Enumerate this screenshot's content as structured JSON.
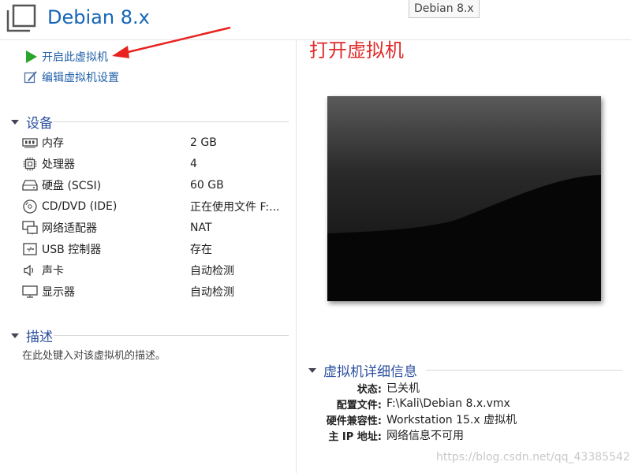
{
  "window": {
    "title": "Debian 8.x",
    "tooltip": "Debian 8.x"
  },
  "actions": [
    {
      "label": "开启此虚拟机",
      "icon": "play-icon"
    },
    {
      "label": "编辑虚拟机设置",
      "icon": "edit-settings-icon"
    }
  ],
  "devices": {
    "header": "设备",
    "items": [
      {
        "name": "内存",
        "value": "2 GB",
        "icon": "memory-icon"
      },
      {
        "name": "处理器",
        "value": "4",
        "icon": "cpu-icon"
      },
      {
        "name": "硬盘 (SCSI)",
        "value": "60 GB",
        "icon": "hard-disk-icon"
      },
      {
        "name": "CD/DVD (IDE)",
        "value": "正在使用文件 F:...",
        "icon": "cd-dvd-icon"
      },
      {
        "name": "网络适配器",
        "value": "NAT",
        "icon": "network-adapter-icon"
      },
      {
        "name": "USB 控制器",
        "value": "存在",
        "icon": "usb-icon"
      },
      {
        "name": "声卡",
        "value": "自动检测",
        "icon": "sound-icon"
      },
      {
        "name": "显示器",
        "value": "自动检测",
        "icon": "display-icon"
      }
    ]
  },
  "description": {
    "header": "描述",
    "text": "在此处键入对该虚拟机的描述。"
  },
  "annotation": {
    "text": "打开虚拟机",
    "color": "#e22a2a"
  },
  "details": {
    "header": "虚拟机详细信息",
    "rows": [
      {
        "label": "状态:",
        "value": "已关机"
      },
      {
        "label": "配置文件:",
        "value": "F:\\Kali\\Debian 8.x.vmx"
      },
      {
        "label": "硬件兼容性:",
        "value": "Workstation 15.x 虚拟机"
      },
      {
        "label": "主 IP 地址:",
        "value": "网络信息不可用"
      }
    ]
  },
  "watermark": "https://blog.csdn.net/qq_43385542",
  "colors": {
    "title": "#1565b7",
    "link": "#1f5fa8",
    "section": "#2c4f9e",
    "play": "#2aa52a"
  }
}
